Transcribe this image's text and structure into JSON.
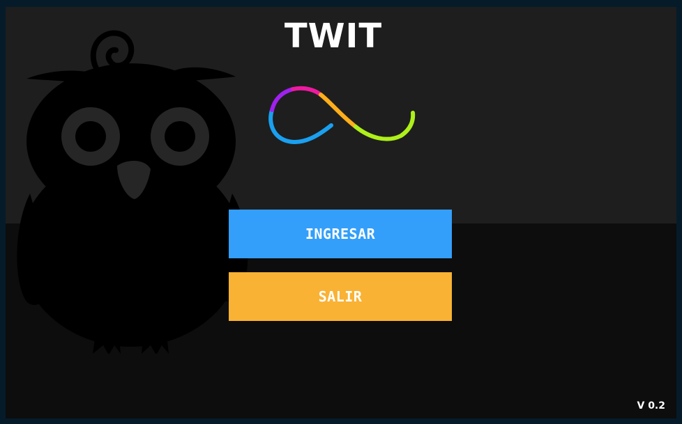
{
  "app": {
    "title": "TWIT",
    "version": "V 0.2"
  },
  "menu": {
    "ingresar_label": "INGRESAR",
    "salir_label": "SALIR"
  },
  "icons": {
    "mascot": "owl-silhouette-icon",
    "logo": "infinity-logo-icon"
  },
  "colors": {
    "ingresar_button": "#339ffa",
    "salir_button": "#f9b233",
    "top_band": "#1e1e1e",
    "bottom_band": "#0d0d0d",
    "frame": "#061b2a"
  }
}
